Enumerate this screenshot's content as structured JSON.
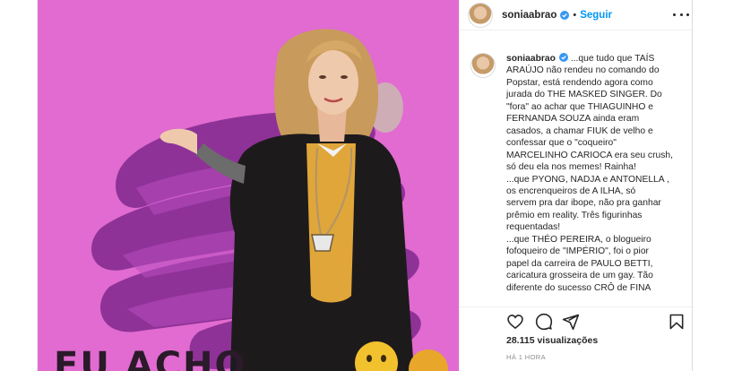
{
  "post": {
    "username": "soniaabrao",
    "separator": "•",
    "follow_label": "Seguir",
    "image_caption": "EU ACHO",
    "caption_lines": [
      "...que tudo que TAÍS",
      "ARAÚJO não rendeu no comando do",
      "Popstar, está rendendo agora como",
      "jurada do THE MASKED SINGER. Do",
      "\"fora\" ao achar que THIAGUINHO e",
      "FERNANDA SOUZA ainda eram",
      "casados, a chamar FIUK de velho e",
      "confessar que o \"coqueiro\"",
      "MARCELINHO CARIOCA era seu crush,",
      "só deu ela nos memes! Rainha!",
      "...que PYONG, NADJA e ANTONELLA ,",
      "os encrenqueiros de A ILHA, só",
      "servem pra dar ibope, não pra ganhar",
      "prêmio em reality. Três figurinhas",
      "requentadas!",
      "...que THÉO PEREIRA, o blogueiro",
      "fofoqueiro de \"IMPÉRIO\", foi o pior",
      "papel da carreira de PAULO BETTI,",
      "caricatura grosseira de um gay. Tão",
      "diferente do sucesso CRÔ de FINA"
    ],
    "views_count": "28.115",
    "views_label": "visualizações",
    "time_label": "HÁ 1 HORA"
  },
  "colors": {
    "accent": "#0095f6",
    "background_pink": "#e16bd0",
    "brush_purple": "#8a2f95"
  },
  "icons": [
    "verified-badge-icon",
    "more-options-icon",
    "heart-icon",
    "comment-icon",
    "share-icon",
    "bookmark-icon",
    "emoji-face-icon"
  ]
}
